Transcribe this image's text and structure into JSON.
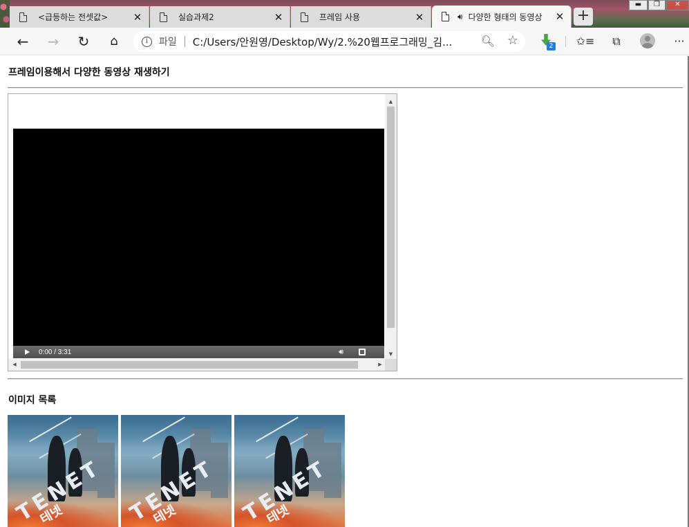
{
  "browser": {
    "tabs": [
      {
        "title": "<급등하는 전셋값>",
        "active": false
      },
      {
        "title": "실습과제2",
        "active": false
      },
      {
        "title": "프레임 사용",
        "active": false
      },
      {
        "title": "다양한 형태의 동영상",
        "active": true,
        "audio": true
      }
    ],
    "new_tab_label": "+",
    "address": {
      "protocol_label": "파일",
      "url": "C:/Users/안원영/Desktop/Wy/2.%20웹프로그래밍_김..."
    },
    "extension_badge": "2",
    "menu_label": "···",
    "window_controls": {
      "minimize": "▬",
      "restore": "❐",
      "close": "✕"
    }
  },
  "page": {
    "heading": "프레임이용해서 다양한 동영상 재생하기",
    "video": {
      "time": "0:00 / 3:31"
    },
    "images_heading": "이미지 목록",
    "posters": [
      {
        "title": "TENET",
        "title_ko": "테넷"
      },
      {
        "title": "TENET",
        "title_ko": "테넷"
      },
      {
        "title": "TENET",
        "title_ko": "테넷"
      }
    ]
  },
  "colors": {
    "video_bg": "#000000",
    "toolbar_bg": "#f7f7f7",
    "tab_inactive": "#dcdcdc",
    "extension_green": "#46a546",
    "badge_blue": "#1e7ee8"
  }
}
